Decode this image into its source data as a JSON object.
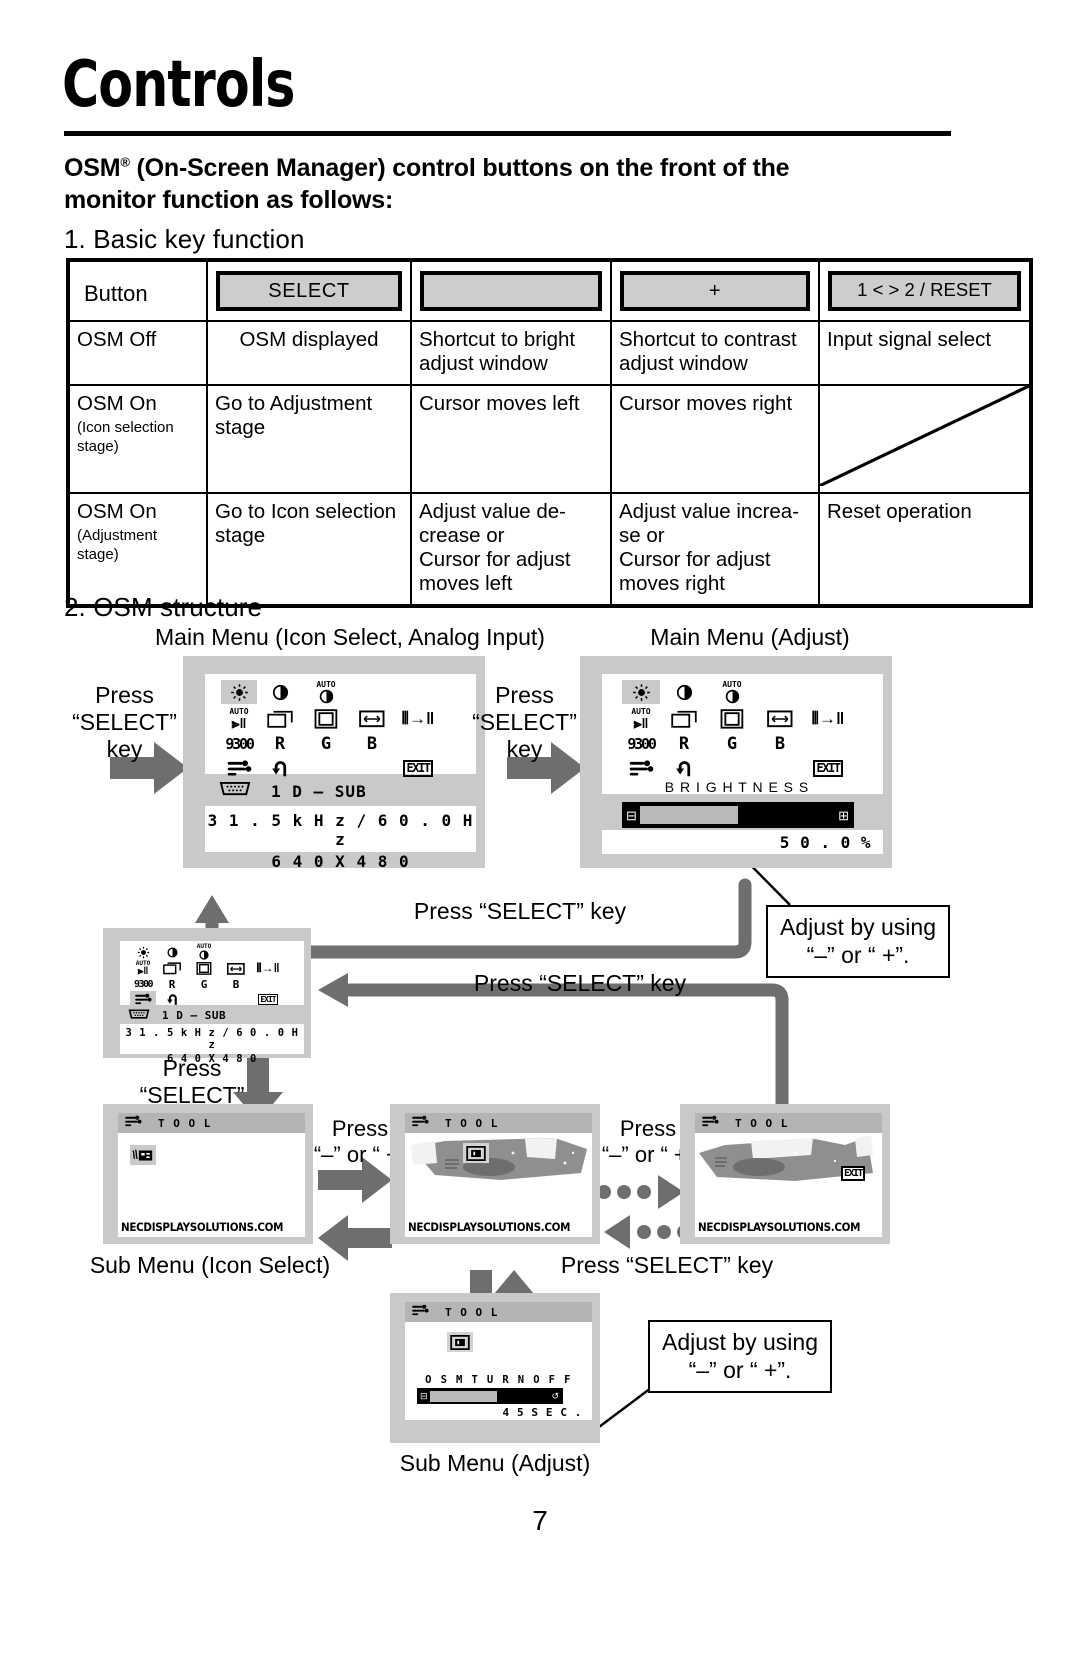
{
  "page": {
    "title": "Controls",
    "lead_line1": "OSM",
    "lead_reg": "®",
    "lead_line1b": " (On-Screen Manager) control buttons on the front of the",
    "lead_line2": "monitor function as follows:",
    "section1": "1. Basic key function",
    "section2": "2. OSM structure",
    "page_number": "7"
  },
  "key_table": {
    "row_header_label": "Button",
    "buttons": [
      "SELECT",
      "",
      "+",
      "1 < > 2 / RESET"
    ],
    "rows": [
      {
        "state": "OSM Off",
        "state_sub": "",
        "cells": [
          "OSM displayed",
          "Shortcut to bright adjust window",
          "Shortcut to contrast adjust window",
          "Input signal select"
        ]
      },
      {
        "state": "OSM On",
        "state_sub": "(Icon selection stage)",
        "cells": [
          "Go to Adjustment stage",
          "Cursor moves left",
          "Cursor moves right",
          ""
        ]
      },
      {
        "state": "OSM On",
        "state_sub": "(Adjustment stage)",
        "cells": [
          "Go to Icon selection stage",
          "Adjust value de-crease or\nCursor for adjust moves left",
          "Adjust value increa-se or\nCursor for adjust moves right",
          "Reset operation"
        ]
      }
    ]
  },
  "structure": {
    "caption_main_icon": "Main Menu (Icon Select, Analog Input)",
    "caption_main_adjust": "Main Menu (Adjust)",
    "caption_sub_icon": "Sub Menu (Icon Select)",
    "caption_sub_adjust": "Sub Menu (Adjust)",
    "press_select_multiline": "Press\n“SELECT”\nkey",
    "press_select_inline": "Press “SELECT” key",
    "press_plus_minus": "Press\n“–” or “ +”",
    "adjust_note": "Adjust by using\n“–” or “ +”."
  },
  "osm_main": {
    "row1": [
      "brightness-icon",
      "contrast-icon",
      "auto-contrast-icon"
    ],
    "row2": [
      "auto-adjust-icon",
      "h-position-icon",
      "v-position-icon",
      "h-size-icon",
      "fine-icon"
    ],
    "row3": [
      "9300",
      "R",
      "G",
      "B"
    ],
    "row4": [
      "tool-icon",
      "reset-icon",
      "EXIT"
    ],
    "selected": "brightness-icon",
    "connector_label": "1  D – SUB",
    "freq_line": "3 1 . 5 k H z /   6 0 . 0 H z",
    "res_line": "6 4 0 X 4 8 0"
  },
  "osm_adjust": {
    "selected": "brightness-icon",
    "label": "B R I G H T N E S S",
    "value": "5 0 . 0 %",
    "bar_percent": 50,
    "minus_glyph": "⊟",
    "plus_glyph": "⊞"
  },
  "osm_tool": {
    "header": "T O O L",
    "footer": "NECDISPLAYSOLUTIONS.COM",
    "screens": [
      {
        "name": "tool-sub-1",
        "icon": "long-cable-icon"
      },
      {
        "name": "tool-sub-2",
        "icon": "osm-turn-off-icon"
      },
      {
        "name": "tool-sub-3",
        "icon": "exit-icon"
      }
    ]
  },
  "osm_tool_adjust": {
    "header": "T O O L",
    "icon": "osm-turn-off-icon",
    "label": "O S M  T U R N  O F F",
    "value": "4 5 S E C .",
    "bar_percent": 56,
    "minus_glyph": "⊟",
    "plus_glyph": "↺"
  },
  "colors": {
    "osm_bezel": "#c9c9c9",
    "arrow_gray": "#6e6e6e",
    "key_fill": "#cdcdcd"
  }
}
